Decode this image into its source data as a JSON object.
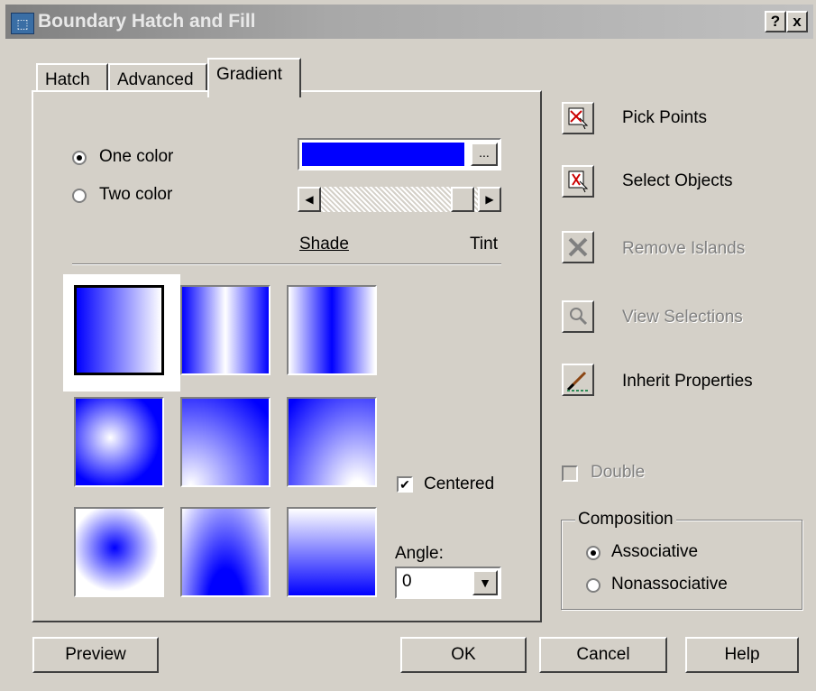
{
  "window": {
    "title": "Boundary Hatch and Fill",
    "help_label": "?",
    "close_label": "x"
  },
  "tabs": [
    {
      "label": "Hatch"
    },
    {
      "label": "Advanced"
    },
    {
      "label": "Gradient"
    }
  ],
  "gradient": {
    "one_color": {
      "label": "One color",
      "selected": true
    },
    "two_color": {
      "label": "Two color",
      "selected": false
    },
    "color_swatch": {
      "color": "#0000ff",
      "browse_label": "..."
    },
    "shade_label": "Shade",
    "tint_label": "Tint",
    "slider_level": 0.95,
    "patterns": [
      "linear",
      "cylinder",
      "inv-cylinder",
      "spherical",
      "hemispherical",
      "curved",
      "inv-spherical",
      "inv-hemispherical",
      "inv-curved"
    ],
    "selected_pattern": 0,
    "centered": {
      "label": "Centered",
      "checked": true
    },
    "angle": {
      "label": "Angle:",
      "value": "0"
    }
  },
  "side": {
    "pick_points": "Pick Points",
    "select_objects": "Select Objects",
    "remove_islands": "Remove Islands",
    "view_selections": "View Selections",
    "inherit_properties": "Inherit Properties",
    "double": "Double",
    "composition": {
      "legend": "Composition",
      "associative": "Associative",
      "nonassociative": "Nonassociative",
      "selected": "Associative"
    }
  },
  "buttons": {
    "preview": "Preview",
    "ok": "OK",
    "cancel": "Cancel",
    "help": "Help"
  },
  "colors": {
    "face": "#d4d0c8",
    "gradient_blue": "#0000ff"
  }
}
